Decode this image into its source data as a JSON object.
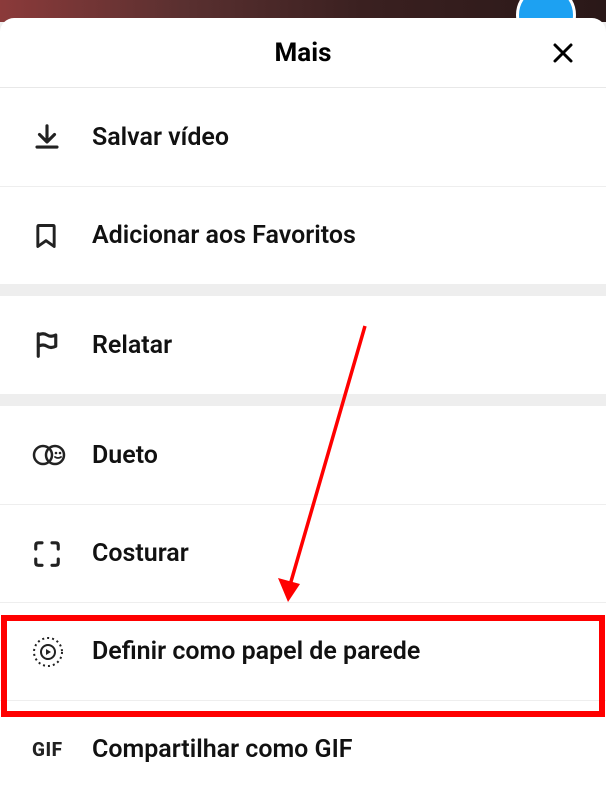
{
  "header": {
    "title": "Mais"
  },
  "items": {
    "save_video": "Salvar vídeo",
    "add_favorites": "Adicionar aos Favoritos",
    "report": "Relatar",
    "duet": "Dueto",
    "stitch": "Costurar",
    "set_wallpaper": "Definir como papel de parede",
    "share_gif": "Compartilhar como GIF"
  },
  "icons": {
    "gif_label": "GIF"
  }
}
